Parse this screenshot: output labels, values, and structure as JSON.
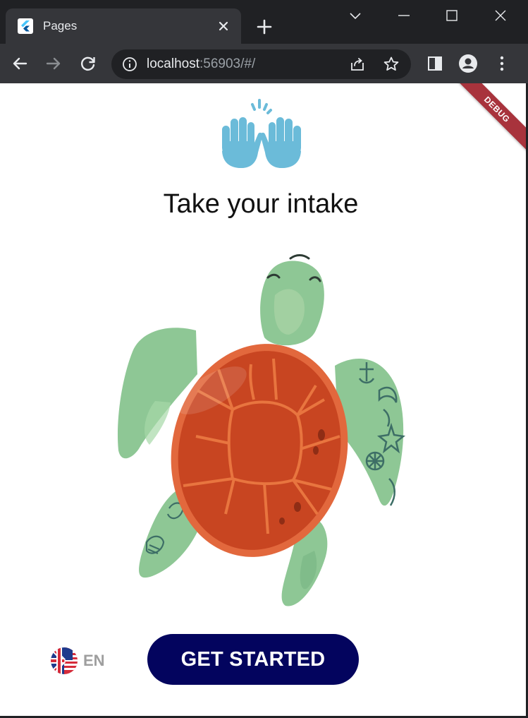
{
  "browser": {
    "tab": {
      "title": "Pages"
    },
    "address": {
      "host": "localhost",
      "rest": ":56903/#/"
    }
  },
  "app": {
    "debug_label": "DEBUG",
    "title": "Take your intake",
    "language": {
      "code": "EN"
    },
    "cta_label": "GET STARTED"
  },
  "colors": {
    "button_bg": "#03045e",
    "hands": "#6bbbd9",
    "turtle_skin": "#8ec795",
    "shell": "#c84521",
    "shell_rim": "#e2683d",
    "debug_banner": "#a8333c"
  }
}
